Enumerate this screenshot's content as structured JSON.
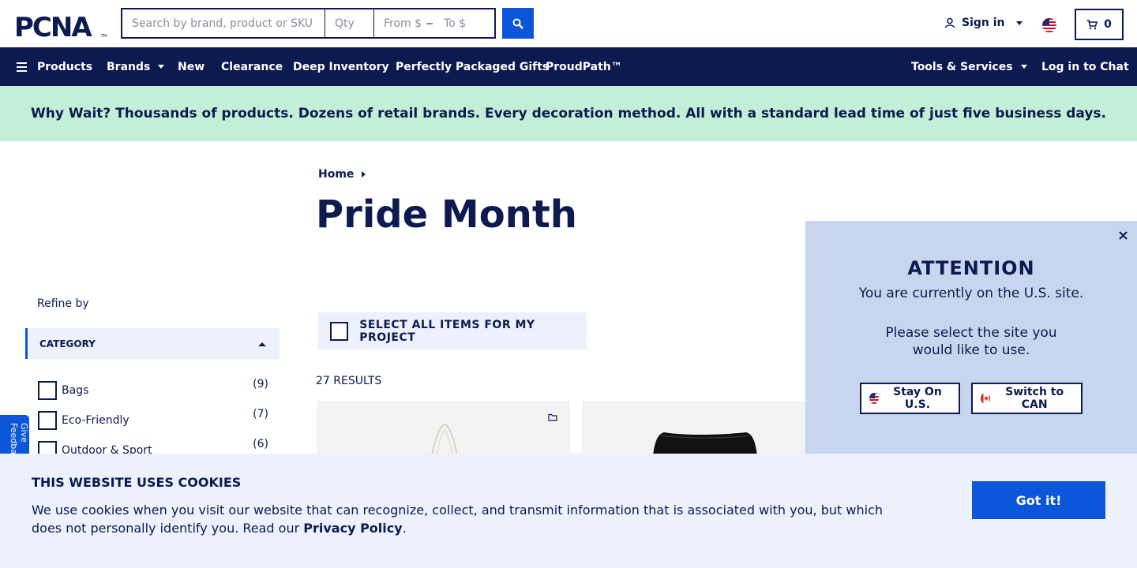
{
  "header": {
    "logo_text": "PCNA",
    "search": {
      "placeholder": "Search by brand, product or SKU",
      "value": ""
    },
    "qty": {
      "placeholder": "Qty",
      "value": ""
    },
    "price_from": {
      "placeholder": "From $",
      "value": ""
    },
    "price_to": {
      "placeholder": "To $",
      "value": ""
    },
    "sign_in_label": "Sign in",
    "cart_count": "0",
    "locale_flag": "us-flag-icon"
  },
  "nav": {
    "items": [
      {
        "label": "Products"
      },
      {
        "label": "Brands"
      },
      {
        "label": "New"
      },
      {
        "label": "Clearance"
      },
      {
        "label": "Deep Inventory"
      },
      {
        "label": "Perfectly Packaged Gifts"
      },
      {
        "label": "ProudPath™"
      },
      {
        "label": "Tools & Services"
      },
      {
        "label": "Log in to Chat"
      }
    ]
  },
  "promo": {
    "text": "Why Wait? Thousands of products. Dozens of retail brands. Every decoration method. All with a standard lead time of just five business days."
  },
  "breadcrumb": {
    "home": "Home"
  },
  "page": {
    "title": "Pride Month"
  },
  "sidebar": {
    "refine_label": "Refine by",
    "category_label": "CATEGORY",
    "filters": [
      {
        "label": "Bags",
        "count": "(9)"
      },
      {
        "label": "Eco-Friendly",
        "count": "(7)"
      },
      {
        "label": "Outdoor & Sport",
        "count": "(6)"
      }
    ]
  },
  "feedback": {
    "label": "Give Feedback"
  },
  "results": {
    "select_all_label": "SELECT ALL ITEMS FOR MY PROJECT",
    "count_label": "27 RESULTS"
  },
  "modal": {
    "title": "ATTENTION",
    "line1": "You are currently on the U.S. site.",
    "line2": "Please select the site you would like to use.",
    "stay_label": "Stay On U.S.",
    "switch_label": "Switch to CAN"
  },
  "cookie": {
    "title": "THIS WEBSITE USES COOKIES",
    "text": "We use cookies when you visit our website that can recognize, collect, and transmit information that is associated with you, but which does not personally identify you. Read our ",
    "link": "Privacy Policy",
    "tail": ".",
    "button": "Got it!"
  },
  "colors": {
    "navy": "#0c1a4f",
    "blue": "#0b56d9",
    "promo_bg": "#c3efd8",
    "modal_bg": "#c7d6ee",
    "cookie_bg": "#ecf1fb"
  }
}
